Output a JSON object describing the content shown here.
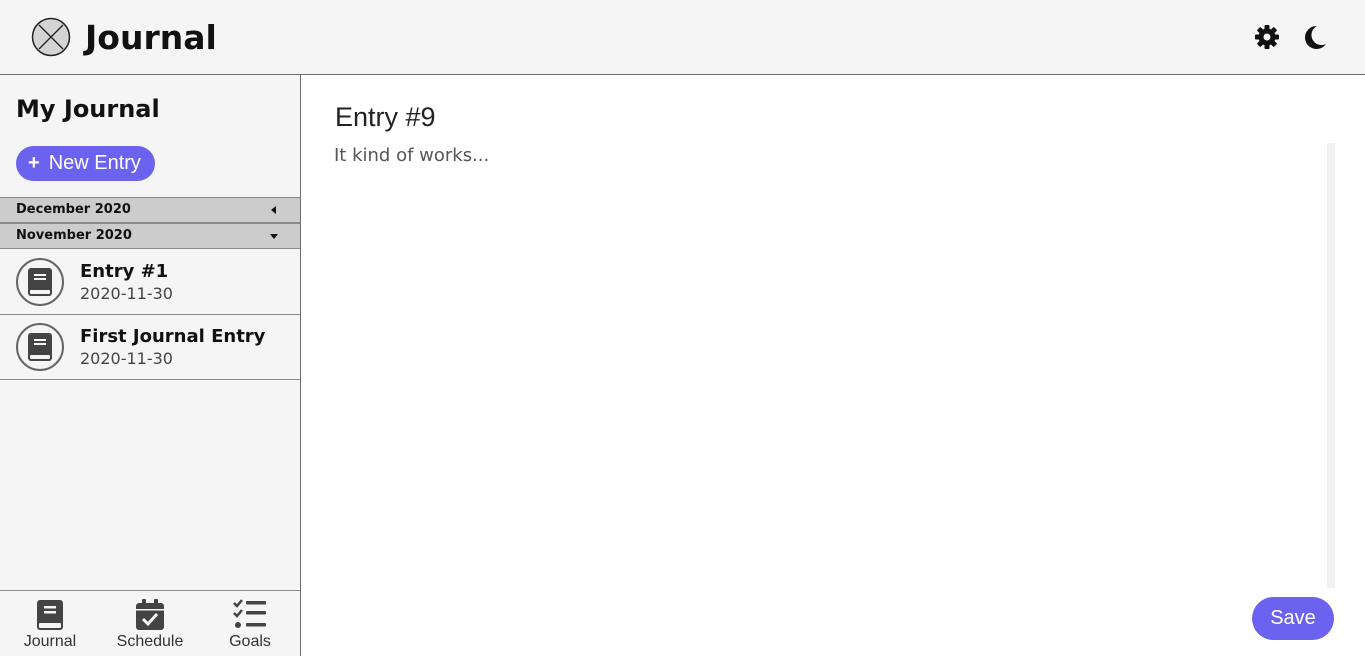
{
  "app": {
    "title": "Journal",
    "logo_icon": "close-circle-icon"
  },
  "header": {
    "settings_icon": "gear-icon",
    "theme_icon": "moon-icon"
  },
  "sidebar": {
    "title": "My Journal",
    "new_entry_label": "New Entry",
    "months": [
      {
        "label": "December 2020",
        "state": "collapsed"
      },
      {
        "label": "November 2020",
        "state": "expanded"
      }
    ],
    "entries": [
      {
        "title": "Entry #1",
        "date": "2020-11-30",
        "icon": "book-icon"
      },
      {
        "title": "First Journal Entry",
        "date": "2020-11-30",
        "icon": "book-icon"
      }
    ]
  },
  "bottom_nav": [
    {
      "label": "Journal",
      "icon": "book-icon"
    },
    {
      "label": "Schedule",
      "icon": "calendar-check-icon"
    },
    {
      "label": "Goals",
      "icon": "checklist-icon"
    }
  ],
  "editor": {
    "heading": "Entry #9",
    "body": "It kind of works...",
    "save_label": "Save"
  },
  "colors": {
    "accent": "#6b63f0",
    "panel": "#f5f5f5",
    "month_header": "#cccccc"
  }
}
